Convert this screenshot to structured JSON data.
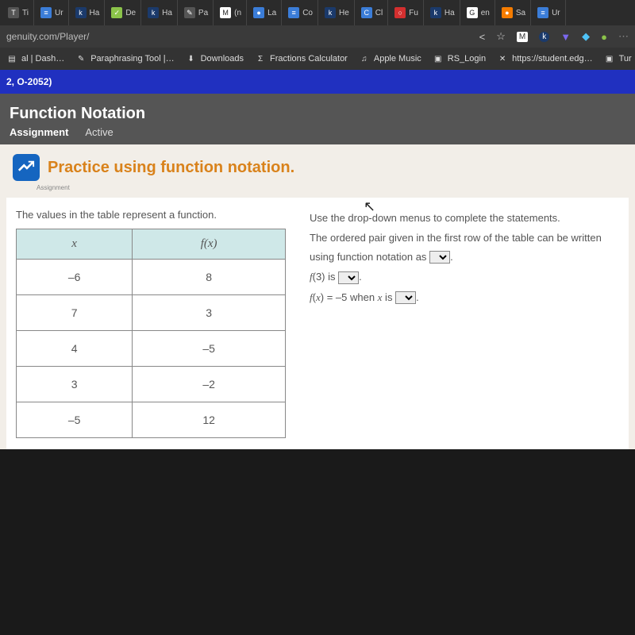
{
  "tabs": [
    {
      "label": "Ti",
      "icon_bg": "ic-gray",
      "icon_txt": "T"
    },
    {
      "label": "Ur",
      "icon_bg": "ic-blue",
      "icon_txt": "≡"
    },
    {
      "label": "Ha",
      "icon_bg": "ic-navy",
      "icon_txt": "k"
    },
    {
      "label": "De",
      "icon_bg": "ic-lime",
      "icon_txt": "✓"
    },
    {
      "label": "Ha",
      "icon_bg": "ic-navy",
      "icon_txt": "k"
    },
    {
      "label": "Pa",
      "icon_bg": "ic-gray",
      "icon_txt": "✎"
    },
    {
      "label": "(n",
      "icon_bg": "ic-white",
      "icon_txt": "M"
    },
    {
      "label": "La",
      "icon_bg": "ic-blue",
      "icon_txt": "●"
    },
    {
      "label": "Co",
      "icon_bg": "ic-blue",
      "icon_txt": "≡"
    },
    {
      "label": "He",
      "icon_bg": "ic-navy",
      "icon_txt": "k"
    },
    {
      "label": "Cl",
      "icon_bg": "ic-blue",
      "icon_txt": "C"
    },
    {
      "label": "Fu",
      "icon_bg": "ic-red",
      "icon_txt": "○"
    },
    {
      "label": "Ha",
      "icon_bg": "ic-navy",
      "icon_txt": "k"
    },
    {
      "label": "en",
      "icon_bg": "ic-white",
      "icon_txt": "G"
    },
    {
      "label": "Sa",
      "icon_bg": "ic-orange",
      "icon_txt": "●"
    },
    {
      "label": "Ur",
      "icon_bg": "ic-blue",
      "icon_txt": "≡"
    }
  ],
  "address": {
    "url": "genuity.com/Player/"
  },
  "bookmarks": [
    {
      "label": "al | Dash…",
      "icon": "▤"
    },
    {
      "label": "Paraphrasing Tool |…",
      "icon": "✎"
    },
    {
      "label": "Downloads",
      "icon": "⬇"
    },
    {
      "label": "Fractions Calculator",
      "icon": "Σ"
    },
    {
      "label": "Apple Music",
      "icon": "♫"
    },
    {
      "label": "RS_Login",
      "icon": "▣"
    },
    {
      "label": "https://student.edg…",
      "icon": "✕"
    },
    {
      "label": "Tur",
      "icon": "▣"
    }
  ],
  "bluebar": {
    "text": "2, O-2052)"
  },
  "header": {
    "title": "Function Notation",
    "sub_bold": "Assignment",
    "sub_light": "Active"
  },
  "lesson": {
    "title": "Practice using function notation.",
    "tag": "Assignment",
    "intro": "The values in the table represent a function.",
    "table": {
      "head_x": "x",
      "head_fx": "f(x)",
      "rows": [
        {
          "x": "–6",
          "fx": "8"
        },
        {
          "x": "7",
          "fx": "3"
        },
        {
          "x": "4",
          "fx": "–5"
        },
        {
          "x": "3",
          "fx": "–2"
        },
        {
          "x": "–5",
          "fx": "12"
        }
      ]
    },
    "right": {
      "line1": "Use the drop-down menus to complete the statements.",
      "line2a": "The ordered pair given in the first row of the table can be written using function notation as",
      "line3a": "f(3) is",
      "line4a": "f(x) = –5 when x is",
      "period": "."
    }
  }
}
